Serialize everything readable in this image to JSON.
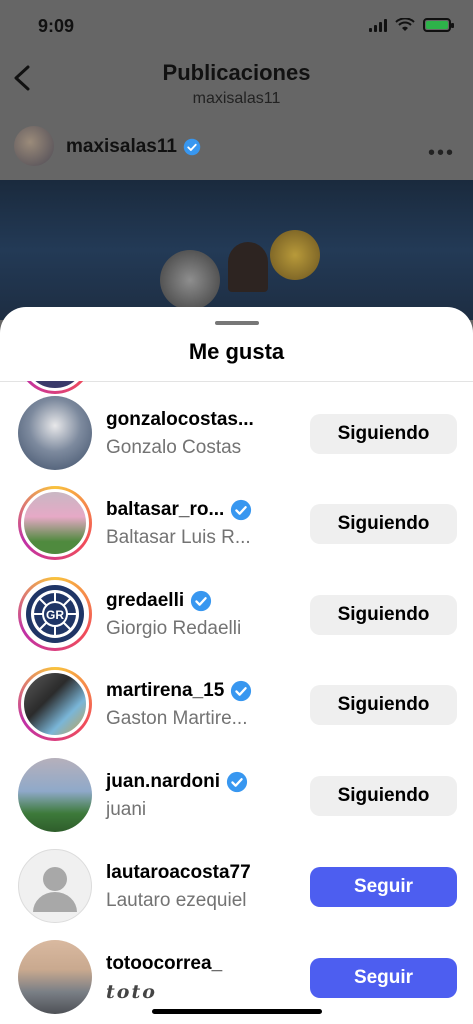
{
  "status": {
    "time": "9:09"
  },
  "nav": {
    "title": "Publicaciones",
    "subtitle": "maxisalas11"
  },
  "post": {
    "username": "maxisalas11",
    "verified": true
  },
  "sheet": {
    "title": "Me gusta"
  },
  "likes": [
    {
      "username": "gonzalocostas...",
      "fullname": "Gonzalo Costas",
      "verified": false,
      "button": "Siguiendo",
      "ring": false
    },
    {
      "username": "baltasar_ro...",
      "fullname": "Baltasar Luis R...",
      "verified": true,
      "button": "Siguiendo",
      "ring": true
    },
    {
      "username": "gredaelli",
      "fullname": "Giorgio Redaelli",
      "verified": true,
      "button": "Siguiendo",
      "ring": true
    },
    {
      "username": "martirena_15",
      "fullname": "Gaston Martire...",
      "verified": true,
      "button": "Siguiendo",
      "ring": true
    },
    {
      "username": "juan.nardoni",
      "fullname": "juani",
      "verified": true,
      "button": "Siguiendo",
      "ring": false
    },
    {
      "username": "lautaroacosta77",
      "fullname": "Lautaro ezequiel",
      "verified": false,
      "button": "Seguir",
      "ring": false
    },
    {
      "username": "totoocorrea_",
      "fullname": "toto",
      "verified": false,
      "button": "Seguir",
      "ring": false
    }
  ],
  "colors": {
    "accent": "#4d5ef0",
    "verified": "#3897f0",
    "following_bg": "#efefef"
  }
}
